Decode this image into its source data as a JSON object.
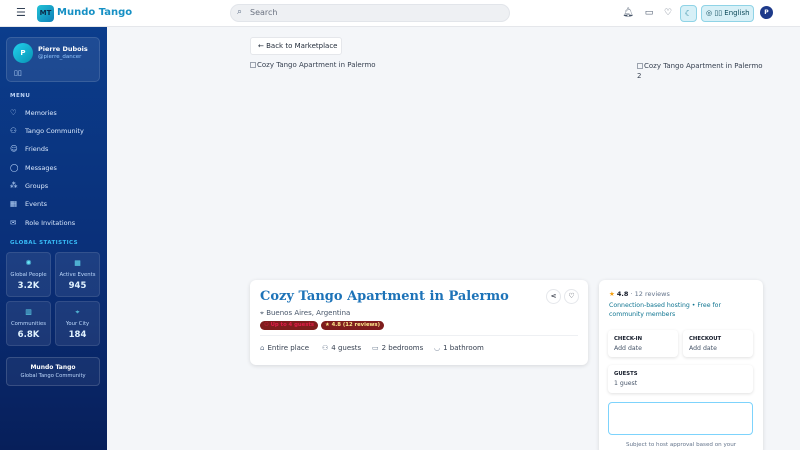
{
  "topbar": {
    "logo_badge": "MT",
    "app_name": "Mundo Tango",
    "search_placeholder": "Search",
    "language": "English",
    "avatar_initial": "P",
    "icons": [
      "menu-icon",
      "search-icon",
      "bell-icon",
      "message-icon",
      "heart-icon",
      "moon-icon",
      "globe-icon",
      "book-icon"
    ]
  },
  "sidebar": {
    "profile": {
      "initial": "P",
      "name": "Pierre Dubois",
      "username": "@pierre_dancer"
    },
    "menu_title": "MENU",
    "items": [
      {
        "label": "Memories",
        "icon": "heart-icon"
      },
      {
        "label": "Tango Community",
        "icon": "users-icon"
      },
      {
        "label": "Friends",
        "icon": "user-plus-icon"
      },
      {
        "label": "Messages",
        "icon": "message-icon"
      },
      {
        "label": "Groups",
        "icon": "network-icon"
      },
      {
        "label": "Events",
        "icon": "calendar-icon"
      },
      {
        "label": "Role Invitations",
        "icon": "mail-icon"
      }
    ],
    "global_stats_title": "GLOBAL STATISTICS",
    "stats": [
      {
        "label": "Global People",
        "value": "3.2K",
        "icon": "globe-icon"
      },
      {
        "label": "Active Events",
        "value": "945",
        "icon": "calendar-icon"
      },
      {
        "label": "Communities",
        "value": "6.8K",
        "icon": "building-icon"
      },
      {
        "label": "Your City",
        "value": "184",
        "icon": "map-pin-icon"
      }
    ],
    "brand": {
      "title": "Mundo Tango",
      "subtitle": "Global Tango Community"
    }
  },
  "main": {
    "back_label": "Back to Marketplace",
    "image_alt_1": "Cozy Tango Apartment in Palermo",
    "image_alt_2": "Cozy Tango Apartment in Palermo 2",
    "listing": {
      "title": "Cozy Tango Apartment in Palermo",
      "location": "Buenos Aires, Argentina",
      "guests_badge": "Up to 4 guests",
      "rating_badge": "4.8 (12 reviews)",
      "features": [
        {
          "label": "Entire place",
          "icon": "home-icon"
        },
        {
          "label": "4 guests",
          "icon": "users-icon"
        },
        {
          "label": "2 bedrooms",
          "icon": "bed-icon"
        },
        {
          "label": "1 bathroom",
          "icon": "bath-icon"
        }
      ]
    },
    "booking": {
      "rating": "4.8",
      "reviews": "12 reviews",
      "host_text": "Connection-based hosting • Free for community members",
      "checkin_label": "CHECK-IN",
      "checkin_value": "Add date",
      "checkout_label": "CHECKOUT",
      "checkout_value": "Add date",
      "guests_label": "GUESTS",
      "guests_value": "1 guest",
      "approval_text": "Subject to host approval based on your"
    }
  }
}
